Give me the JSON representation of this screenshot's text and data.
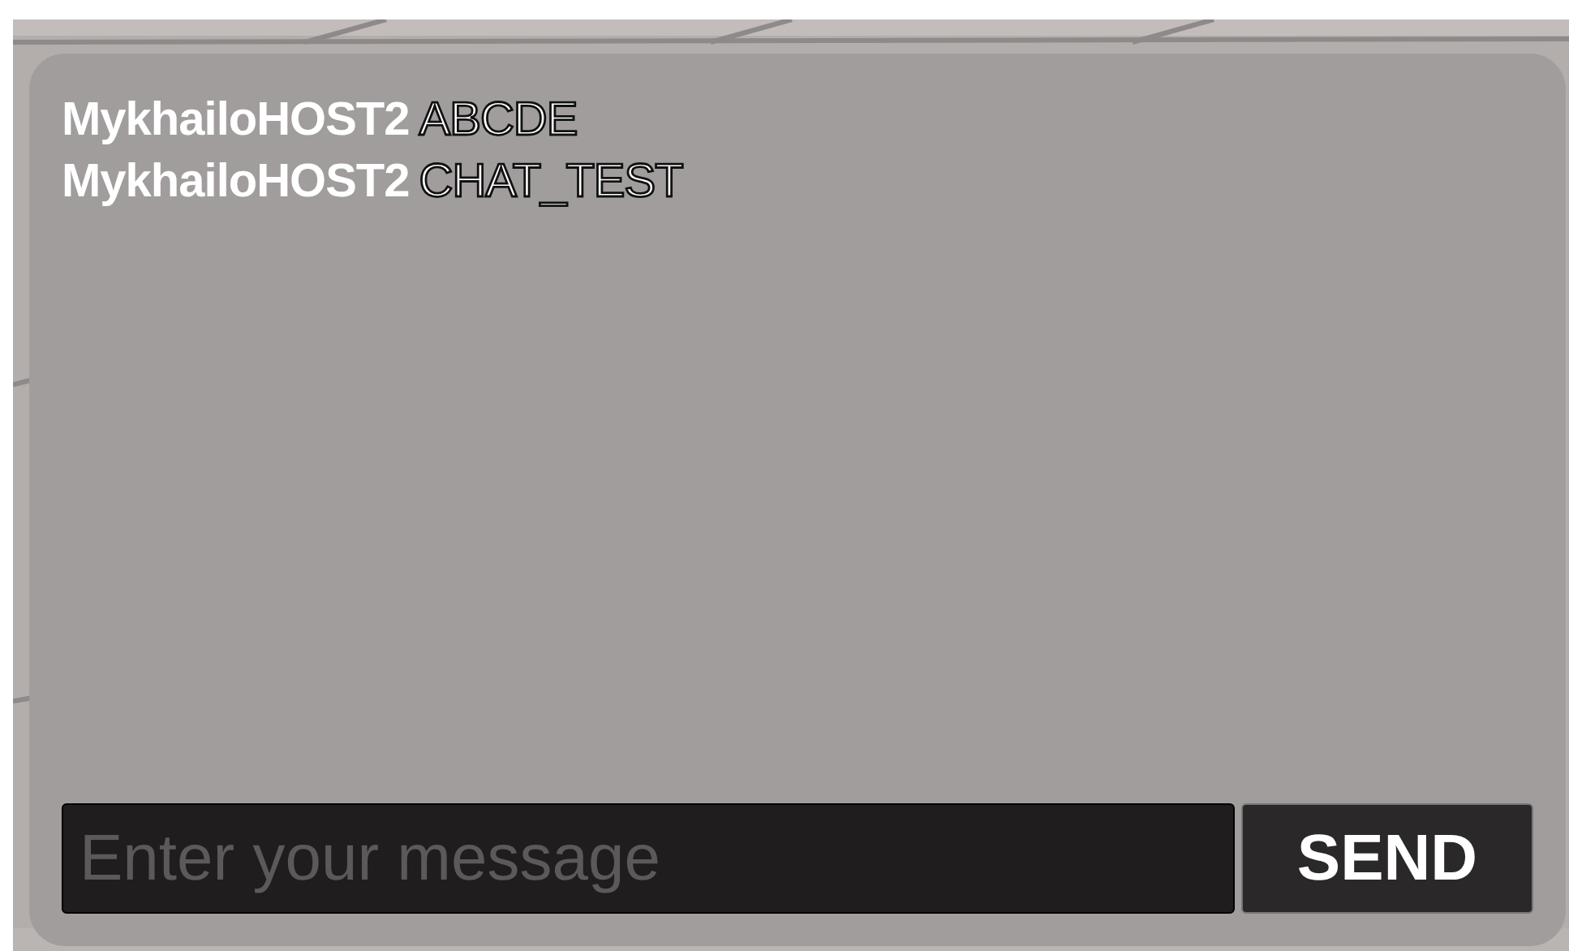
{
  "chat": {
    "messages": [
      {
        "sender": "MykhailoHOST2",
        "text": "ABCDE"
      },
      {
        "sender": "MykhailoHOST2",
        "text": "CHAT_TEST"
      }
    ],
    "input": {
      "placeholder": "Enter your message"
    },
    "send_button": "SEND"
  }
}
